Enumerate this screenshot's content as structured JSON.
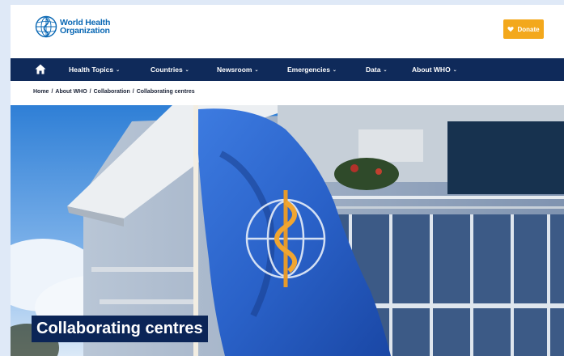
{
  "header": {
    "logo_line1": "World Health",
    "logo_line2": "Organization",
    "donate_label": "Donate"
  },
  "nav": {
    "items": [
      {
        "label": "Health Topics"
      },
      {
        "label": "Countries"
      },
      {
        "label": "Newsroom"
      },
      {
        "label": "Emergencies"
      },
      {
        "label": "Data"
      },
      {
        "label": "About WHO"
      }
    ]
  },
  "breadcrumb": {
    "items": [
      "Home",
      "About WHO",
      "Collaboration",
      "Collaborating centres"
    ]
  },
  "hero": {
    "title": "Collaborating centres"
  },
  "colors": {
    "brand_blue": "#0a68b4",
    "nav_bg": "#0f2a5a",
    "donate": "#f3a81c",
    "title_bg": "#0b2557"
  }
}
